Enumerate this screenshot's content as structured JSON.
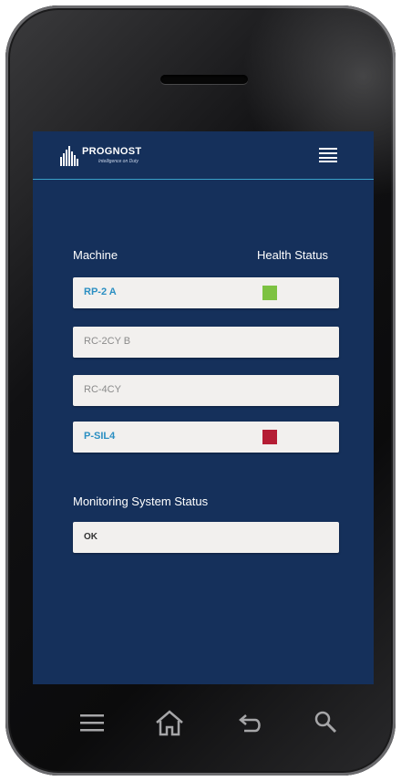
{
  "app": {
    "brand": "PROGNOST",
    "tagline": "Intelligence on Duty"
  },
  "table": {
    "col_machine": "Machine",
    "col_health": "Health Status",
    "rows": [
      {
        "name": "RP-2 A",
        "status_color": "#7dc242",
        "has_status": true
      },
      {
        "name": "RC-2CY B",
        "has_status": false
      },
      {
        "name": "RC-4CY",
        "has_status": false
      },
      {
        "name": "P-SIL4",
        "status_color": "#b51d34",
        "has_status": true
      }
    ]
  },
  "monitoring": {
    "title": "Monitoring System Status",
    "value": "OK"
  },
  "icons": {
    "menu": "hamburger-menu-icon",
    "nav": [
      "menu-icon",
      "home-icon",
      "back-icon",
      "search-icon"
    ]
  },
  "colors": {
    "screen_bg": "#15305b",
    "accent_line": "#3aa0c8",
    "active_text": "#2b8fc2"
  }
}
